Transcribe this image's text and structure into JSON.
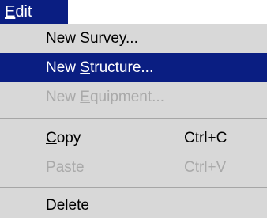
{
  "menu": {
    "title": {
      "mnemonic": "E",
      "rest": "dit"
    },
    "items": [
      {
        "pre": "",
        "mnemonic": "N",
        "post": "ew Survey...",
        "shortcut": "",
        "state": "normal"
      },
      {
        "pre": "New ",
        "mnemonic": "S",
        "post": "tructure...",
        "shortcut": "",
        "state": "highlighted"
      },
      {
        "pre": "New ",
        "mnemonic": "E",
        "post": "quipment...",
        "shortcut": "",
        "state": "disabled"
      },
      {
        "pre": "",
        "mnemonic": "C",
        "post": "opy",
        "shortcut": "Ctrl+C",
        "state": "normal"
      },
      {
        "pre": "",
        "mnemonic": "P",
        "post": "aste",
        "shortcut": "Ctrl+V",
        "state": "disabled"
      },
      {
        "pre": "",
        "mnemonic": "D",
        "post": "elete",
        "shortcut": "",
        "state": "normal"
      }
    ]
  },
  "colors": {
    "highlight": "#0a1e82",
    "menu_background": "#d8d8d8",
    "disabled_text": "#a9a9a9"
  }
}
